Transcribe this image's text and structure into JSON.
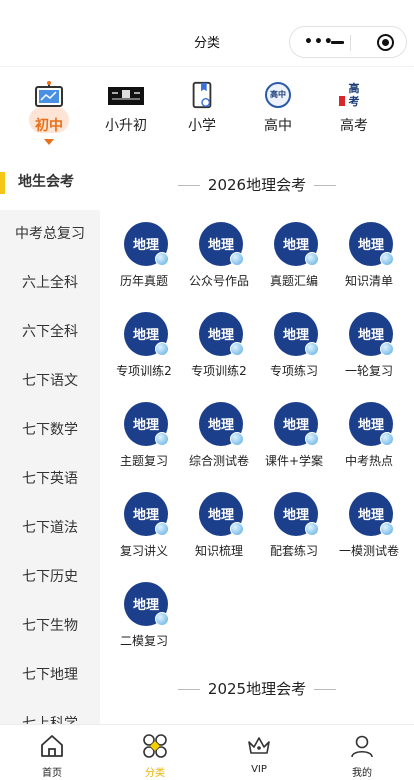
{
  "header": {
    "title": "分类"
  },
  "grades": [
    {
      "label": "初中",
      "icon": "tv-board-icon",
      "active": true
    },
    {
      "label": "小升初",
      "icon": "banner-image-icon",
      "active": false
    },
    {
      "label": "小学",
      "icon": "book-bookmark-icon",
      "active": false
    },
    {
      "label": "高中",
      "icon": "high-school-round-icon",
      "active": false
    },
    {
      "label": "高考",
      "icon": "gaokao-badge-icon",
      "active": false
    }
  ],
  "grade_icon_texts": {
    "gaozhong": "高中",
    "gaokao": "高考"
  },
  "sidebar": {
    "items": [
      "地生会考",
      "中考总复习",
      "六上全科",
      "六下全科",
      "七下语文",
      "七下数学",
      "七下英语",
      "七下道法",
      "七下历史",
      "七下生物",
      "七下地理",
      "七上科学"
    ],
    "active_index": 0
  },
  "content": {
    "section1_title": "2026地理会考",
    "section2_title": "2025地理会考",
    "badge_text": "地理",
    "items": [
      "历年真题",
      "公众号作品",
      "真题汇编",
      "知识清单",
      "专项训练2",
      "专项训练2",
      "专项练习",
      "一轮复习",
      "主题复习",
      "综合测试卷",
      "课件+学案",
      "中考热点",
      "复习讲义",
      "知识梳理",
      "配套练习",
      "一模测试卷",
      "二模复习"
    ]
  },
  "bottom_nav": [
    {
      "label": "首页",
      "icon": "home-icon"
    },
    {
      "label": "分类",
      "icon": "category-icon",
      "active": true
    },
    {
      "label": "VIP",
      "icon": "crown-icon"
    },
    {
      "label": "我的",
      "icon": "user-icon"
    }
  ],
  "colors": {
    "accent_orange": "#e8701a",
    "accent_yellow": "#f5c518",
    "badge_blue": "#1c3f8c",
    "nav_active": "#e9b200"
  }
}
